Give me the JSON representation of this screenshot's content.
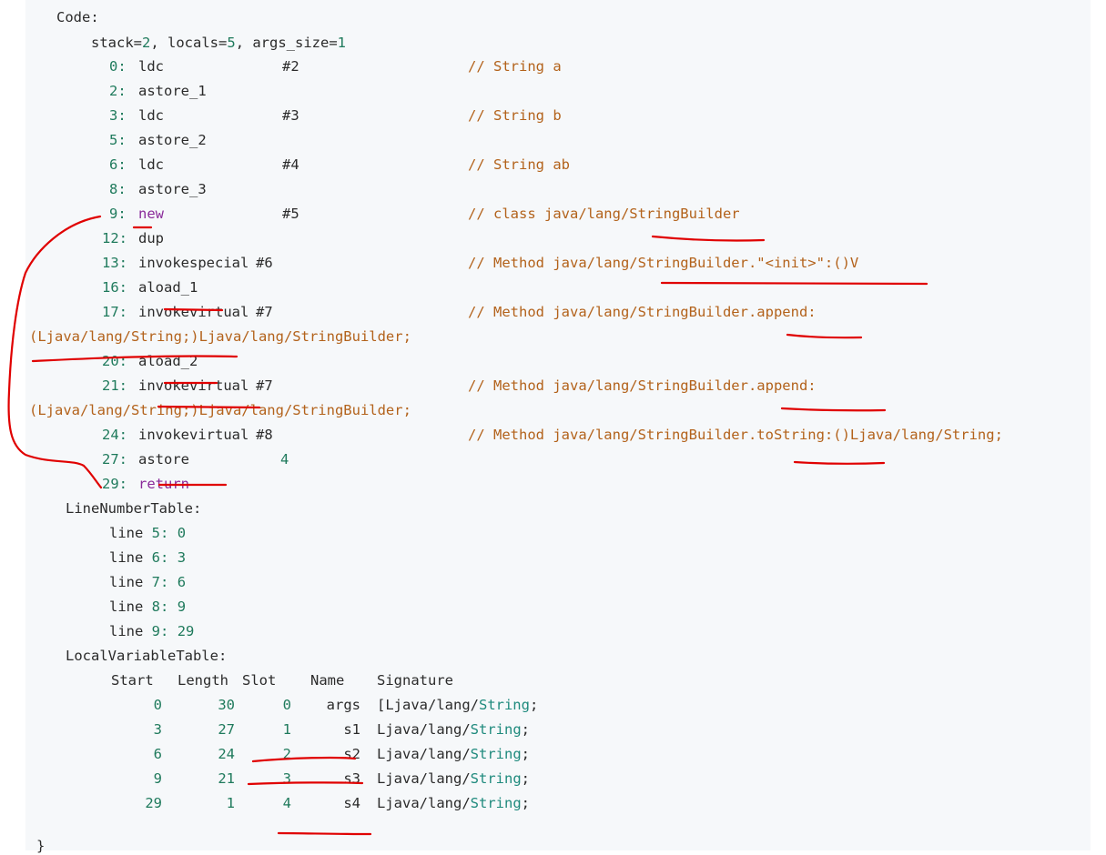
{
  "code": {
    "header": "Code:",
    "stack_prefix": "stack=",
    "stack_value": "2",
    "locals_prefix": ", locals=",
    "locals_value": "5",
    "args_prefix": ", args_size=",
    "args_value": "1",
    "instructions": [
      {
        "offset": "0:",
        "op": "ldc",
        "arg": "#2",
        "comment": "// String a"
      },
      {
        "offset": "2:",
        "op": "astore_1"
      },
      {
        "offset": "3:",
        "op": "ldc",
        "arg": "#3",
        "comment": "// String b"
      },
      {
        "offset": "5:",
        "op": "astore_2"
      },
      {
        "offset": "6:",
        "op": "ldc",
        "arg": "#4",
        "comment": "// String ab"
      },
      {
        "offset": "8:",
        "op": "astore_3"
      },
      {
        "offset": "9:",
        "op": "new",
        "arg": "#5",
        "comment": "// class java/lang/StringBuilder"
      },
      {
        "offset": "12:",
        "op": "dup"
      },
      {
        "offset": "13:",
        "op": "invokespecial",
        "arg": "#6",
        "comment": "// Method java/lang/StringBuilder.\"<init>\":()V"
      },
      {
        "offset": "16:",
        "op": "aload_1"
      },
      {
        "offset": "17:",
        "op": "invokevirtual",
        "arg": "#7",
        "comment": "// Method java/lang/StringBuilder.append:",
        "cont": "(Ljava/lang/String;)Ljava/lang/StringBuilder;"
      },
      {
        "offset": "20:",
        "op": "aload_2"
      },
      {
        "offset": "21:",
        "op": "invokevirtual",
        "arg": "#7",
        "comment": "// Method java/lang/StringBuilder.append:",
        "cont": "(Ljava/lang/String;)Ljava/lang/StringBuilder;"
      },
      {
        "offset": "24:",
        "op": "invokevirtual",
        "arg": "#8",
        "comment": "// Method java/lang/StringBuilder.toString:()Ljava/lang/String;"
      },
      {
        "offset": "27:",
        "op": "astore",
        "arg": "4"
      },
      {
        "offset": "29:",
        "op": "return"
      }
    ]
  },
  "line_number_table": {
    "header": "LineNumberTable:",
    "rows": [
      {
        "line": "line",
        "src": "5:",
        "pc": "0"
      },
      {
        "line": "line",
        "src": "6:",
        "pc": "3"
      },
      {
        "line": "line",
        "src": "7:",
        "pc": "6"
      },
      {
        "line": "line",
        "src": "8:",
        "pc": "9"
      },
      {
        "line": "line",
        "src": "9:",
        "pc": "29"
      }
    ]
  },
  "local_variable_table": {
    "header": "LocalVariableTable:",
    "columns": [
      "Start",
      "Length",
      "Slot",
      "Name",
      "Signature"
    ],
    "rows": [
      {
        "start": "0",
        "length": "30",
        "slot": "0",
        "name": "args",
        "sig_prefix": "[Ljava/lang/",
        "sig_type": "String",
        "sig_suffix": ";"
      },
      {
        "start": "3",
        "length": "27",
        "slot": "1",
        "name": "s1",
        "sig_prefix": "Ljava/lang/",
        "sig_type": "String",
        "sig_suffix": ";"
      },
      {
        "start": "6",
        "length": "24",
        "slot": "2",
        "name": "s2",
        "sig_prefix": "Ljava/lang/",
        "sig_type": "String",
        "sig_suffix": ";"
      },
      {
        "start": "9",
        "length": "21",
        "slot": "3",
        "name": "s3",
        "sig_prefix": "Ljava/lang/",
        "sig_type": "String",
        "sig_suffix": ";"
      },
      {
        "start": "29",
        "length": "1",
        "slot": "4",
        "name": "s4",
        "sig_prefix": "Ljava/lang/",
        "sig_type": "String",
        "sig_suffix": ";"
      }
    ]
  },
  "closing_brace": "}",
  "colors": {
    "background": "#f6f8fa",
    "text": "#2b2b2b",
    "number": "#1f7a5c",
    "keyword": "#8a2b9a",
    "comment": "#b3621b",
    "type": "#1f8a7d",
    "annotation": "#e00000"
  }
}
